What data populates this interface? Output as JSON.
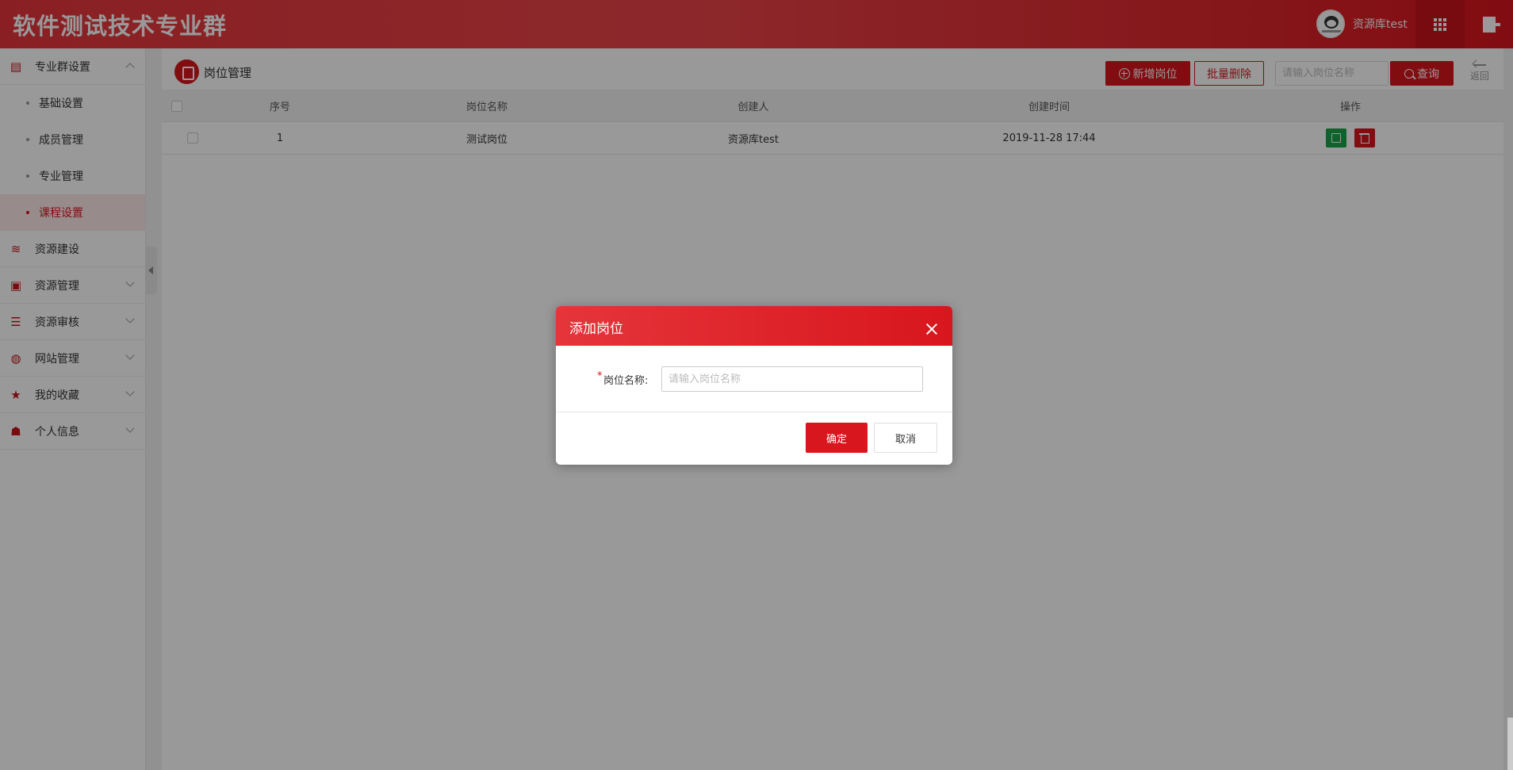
{
  "header": {
    "app_title": "软件测试技术专业群",
    "username": "资源库test"
  },
  "sidebar": {
    "groups": [
      {
        "label": "专业群设置",
        "icon": "clipboard-icon",
        "expanded": true,
        "children": [
          {
            "label": "基础设置"
          },
          {
            "label": "成员管理"
          },
          {
            "label": "专业管理"
          },
          {
            "label": "课程设置",
            "active": true
          }
        ]
      },
      {
        "label": "资源建设",
        "icon": "layers-icon"
      },
      {
        "label": "资源管理",
        "icon": "book-icon"
      },
      {
        "label": "资源审核",
        "icon": "list-icon"
      },
      {
        "label": "网站管理",
        "icon": "globe-icon"
      },
      {
        "label": "我的收藏",
        "icon": "star-icon"
      },
      {
        "label": "个人信息",
        "icon": "user-card-icon"
      }
    ]
  },
  "toolbar": {
    "page_title": "岗位管理",
    "add_label": "新增岗位",
    "batch_delete_label": "批量删除",
    "search_placeholder": "请输入岗位名称",
    "query_label": "查询",
    "back_label": "返回"
  },
  "table": {
    "columns": [
      "序号",
      "岗位名称",
      "创建人",
      "创建时间",
      "操作"
    ],
    "rows": [
      {
        "index": "1",
        "name": "测试岗位",
        "creator": "资源库test",
        "created_at": "2019-11-28 17:44"
      }
    ]
  },
  "dialog": {
    "title": "添加岗位",
    "field_label": "岗位名称:",
    "field_required_mark": "*",
    "field_placeholder": "请输入岗位名称",
    "field_value": "",
    "ok_label": "确定",
    "cancel_label": "取消"
  },
  "colors": {
    "brand_red": "#d8161d",
    "edit_green": "#1aa34a"
  }
}
